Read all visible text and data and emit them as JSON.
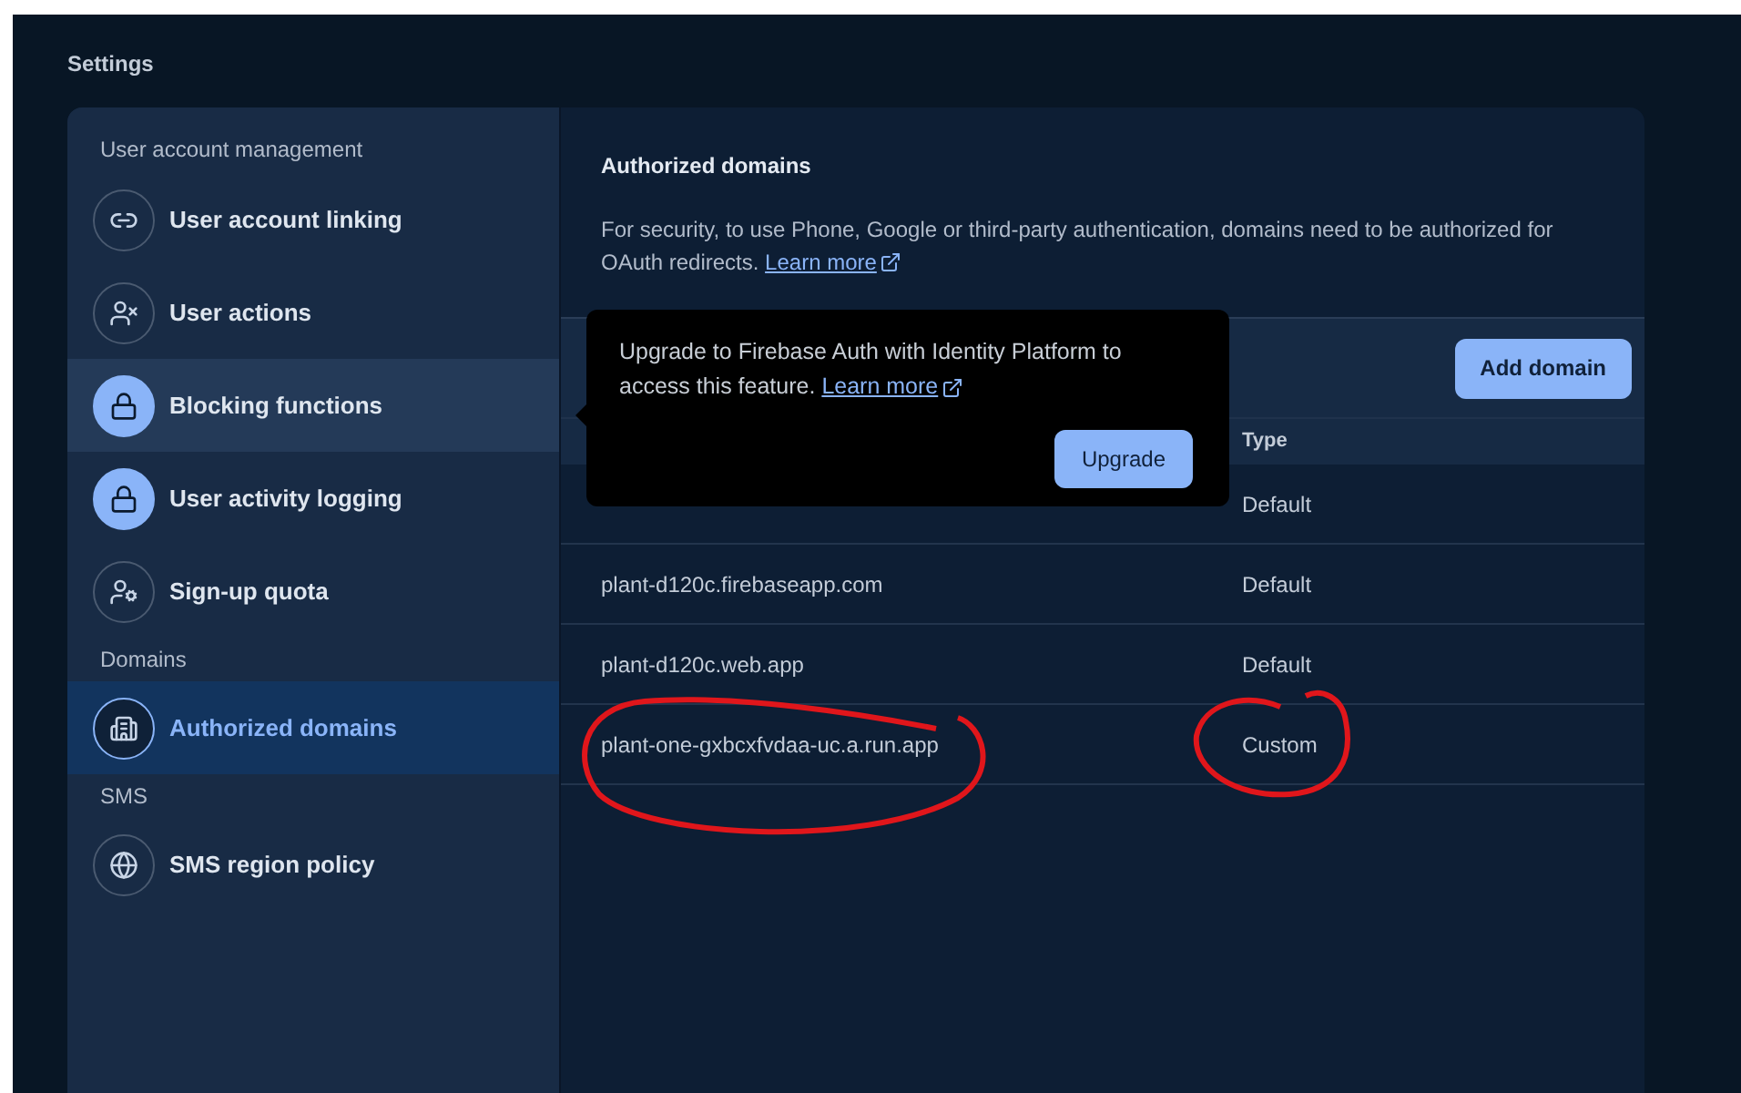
{
  "page_title": "Settings",
  "sidebar": {
    "sections": [
      {
        "label": "User account management",
        "items": [
          {
            "label": "User account linking",
            "kind": "outline",
            "selected": false,
            "highlighted": false
          },
          {
            "label": "User actions",
            "kind": "outline",
            "selected": false,
            "highlighted": false
          },
          {
            "label": "Blocking functions",
            "kind": "filled",
            "selected": false,
            "highlighted": true
          },
          {
            "label": "User activity logging",
            "kind": "filled",
            "selected": false,
            "highlighted": false
          },
          {
            "label": "Sign-up quota",
            "kind": "outline",
            "selected": false,
            "highlighted": false
          }
        ]
      },
      {
        "label": "Domains",
        "items": [
          {
            "label": "Authorized domains",
            "kind": "outline",
            "selected": true,
            "highlighted": false
          }
        ]
      },
      {
        "label": "SMS",
        "items": [
          {
            "label": "SMS region policy",
            "kind": "outline",
            "selected": false,
            "highlighted": false
          }
        ]
      }
    ]
  },
  "content": {
    "title": "Authorized domains",
    "description": "For security, to use Phone, Google or third-party authentication, domains need to be authorized for OAuth redirects.",
    "link": "Learn more",
    "add_button": "Add domain",
    "table": {
      "columns": [
        "Type"
      ],
      "rows": [
        {
          "type": "Default"
        },
        {
          "domain": "plant-d120c.firebaseapp.com",
          "type": "Default"
        },
        {
          "domain": "plant-d120c.web.app",
          "type": "Default"
        },
        {
          "domain": "plant-one-gxbcxfvdaa-uc.a.run.app",
          "type": "Custom"
        }
      ]
    }
  },
  "popup": {
    "text": "Upgrade to Firebase Auth with Identity Platform to access this feature.",
    "link": "Learn more",
    "button": "Upgrade"
  }
}
